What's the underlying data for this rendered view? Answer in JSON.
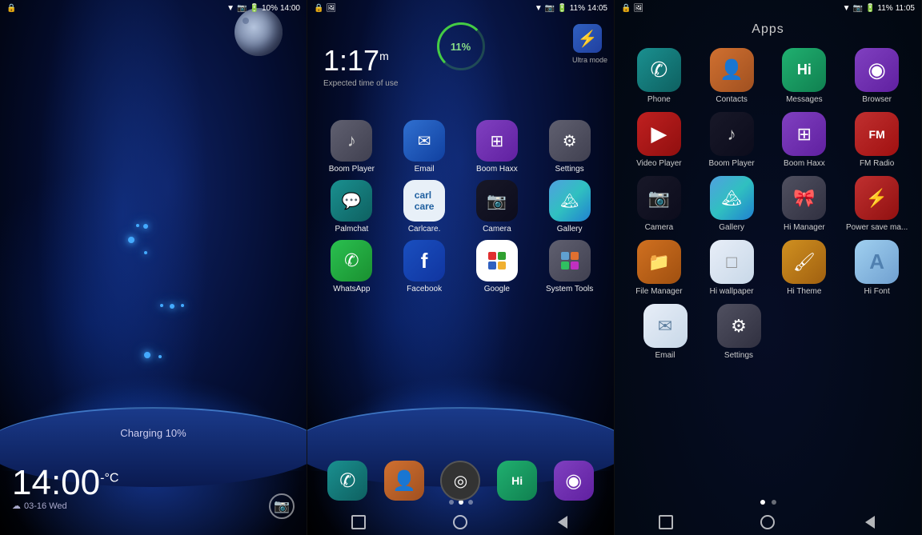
{
  "panel1": {
    "status": {
      "left_icon": "📶",
      "signal": "▼",
      "camera_icon": "📷",
      "battery": "10%",
      "time": "14:00"
    },
    "time_display": "14:00",
    "temp": "-°C",
    "date": "03-16 Wed",
    "charging": "Charging 10%"
  },
  "panel2": {
    "status": {
      "battery": "11%",
      "time": "14:05"
    },
    "clock": {
      "time": "1:17",
      "suffix": "m",
      "label": "Expected time of use"
    },
    "battery_pct": "11%",
    "ultra_label": "Ultra mode",
    "apps": [
      {
        "label": "Boom Player",
        "icon": "♪",
        "color": "icon-gray"
      },
      {
        "label": "Email",
        "icon": "✉",
        "color": "icon-blue"
      },
      {
        "label": "Boom Haxx",
        "icon": "⚙",
        "color": "icon-purple"
      },
      {
        "label": "Settings",
        "icon": "⚙",
        "color": "icon-gray"
      }
    ],
    "apps2": [
      {
        "label": "Palmchat",
        "icon": "💬",
        "color": "icon-teal"
      },
      {
        "label": "Carlcare.",
        "icon": "🔧",
        "color": "icon-light"
      },
      {
        "label": "Camera",
        "icon": "📷",
        "color": "icon-dark"
      },
      {
        "label": "Gallery",
        "icon": "🏔",
        "color": "gallery-icon"
      }
    ],
    "apps3": [
      {
        "label": "WhatsApp",
        "icon": "✆",
        "color": "icon-whatsapp"
      },
      {
        "label": "Facebook",
        "icon": "f",
        "color": "icon-fbblue"
      },
      {
        "label": "Google",
        "icon": "G",
        "color": "icon-red"
      },
      {
        "label": "System Tools",
        "icon": "⊞",
        "color": "icon-gray"
      }
    ],
    "dock": [
      {
        "label": "Phone",
        "icon": "✆",
        "color": "icon-teal"
      },
      {
        "label": "Contacts",
        "icon": "👤",
        "color": "icon-orange"
      },
      {
        "label": "Launcher",
        "icon": "◎",
        "color": "icon-gray"
      },
      {
        "label": "Hi",
        "icon": "Hi",
        "color": "icon-higreen"
      },
      {
        "label": "Browser",
        "icon": "◉",
        "color": "icon-purple"
      }
    ]
  },
  "panel3": {
    "title": "Apps",
    "status": {
      "battery": "11%",
      "time": "11:05"
    },
    "rows": [
      [
        {
          "label": "Phone",
          "icon": "✆",
          "color": "icon-teal"
        },
        {
          "label": "Contacts",
          "icon": "👤",
          "color": "icon-orange"
        },
        {
          "label": "Messages",
          "icon": "Hi",
          "color": "icon-higreen"
        },
        {
          "label": "Browser",
          "icon": "◉",
          "color": "icon-purple"
        }
      ],
      [
        {
          "label": "Video Player",
          "icon": "▶",
          "color": "icon-boom"
        },
        {
          "label": "Boom Player",
          "icon": "♪",
          "color": "icon-dark"
        },
        {
          "label": "Boom Haxx",
          "icon": "⚙",
          "color": "icon-purple"
        },
        {
          "label": "FM Radio",
          "icon": "FM",
          "color": "icon-red"
        }
      ],
      [
        {
          "label": "Camera",
          "icon": "📷",
          "color": "icon-dark"
        },
        {
          "label": "Gallery",
          "icon": "🏔",
          "color": "gallery-icon"
        },
        {
          "label": "Hi Manager",
          "icon": "🎀",
          "color": "settings-icon-color"
        },
        {
          "label": "Power save ma...",
          "icon": "⚡",
          "color": "icon-redcam"
        }
      ],
      [
        {
          "label": "File Manager",
          "icon": "📁",
          "color": "icon-fileorange"
        },
        {
          "label": "Hi wallpaper",
          "icon": "□",
          "color": "icon-white"
        },
        {
          "label": "Hi Theme",
          "icon": "🖌",
          "color": "icon-theme"
        },
        {
          "label": "Hi Font",
          "icon": "A",
          "color": "icon-font"
        }
      ],
      [
        {
          "label": "Email",
          "icon": "✉",
          "color": "icon-light"
        },
        {
          "label": "Settings",
          "icon": "⚙",
          "color": "settings-icon-color"
        },
        null,
        null
      ]
    ]
  },
  "nav": {
    "square": "□",
    "circle": "○",
    "triangle": "◁"
  }
}
